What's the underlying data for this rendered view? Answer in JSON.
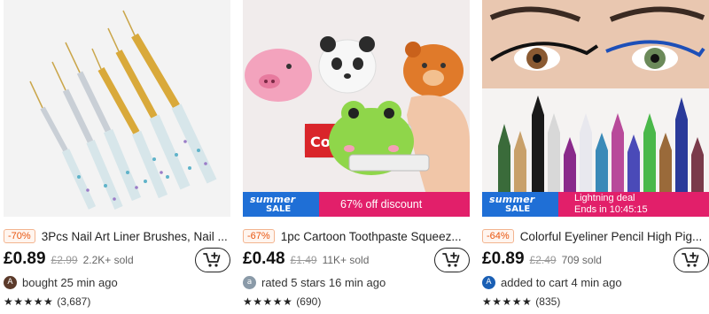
{
  "products": [
    {
      "discount": "-70%",
      "title": "3Pcs Nail Art Liner Brushes, Nail ...",
      "price": "£0.89",
      "old_price": "£2.99",
      "sold": "2.2K+ sold",
      "avatar_letter": "A",
      "avatar_color": "#5b3a2a",
      "activity": "bought 25 min ago",
      "stars": "★★★★★",
      "rating_value": 4.5,
      "rating_count": "(3,687)"
    },
    {
      "discount": "-67%",
      "title": "1pc Cartoon Toothpaste Squeez...",
      "price": "£0.48",
      "old_price": "£1.49",
      "sold": "11K+ sold",
      "avatar_letter": "a",
      "avatar_color": "#8a9aa8",
      "activity": "rated 5 stars 16 min ago",
      "stars": "★★★★★",
      "rating_value": 4.5,
      "rating_count": "(690)",
      "banner": {
        "summer": "summer",
        "sale": "SALE",
        "promo": "67% off discount"
      }
    },
    {
      "discount": "-64%",
      "title": "Colorful Eyeliner Pencil High Pig...",
      "price": "£0.89",
      "old_price": "£2.49",
      "sold": "709 sold",
      "avatar_letter": "A",
      "avatar_color": "#1a5fb4",
      "activity": "added to cart 4 min ago",
      "stars": "★★★★★",
      "rating_value": 4.5,
      "rating_count": "(835)",
      "banner": {
        "summer": "summer",
        "sale": "SALE",
        "promo_line1": "Lightning deal",
        "promo_line2": "Ends in 10:45:15"
      }
    }
  ],
  "colors": {
    "discount_text": "#e8550f",
    "banner_blue": "#1f6fd6",
    "banner_pink": "#e21f6a"
  },
  "icons": {
    "cart": "add-to-cart-icon"
  }
}
